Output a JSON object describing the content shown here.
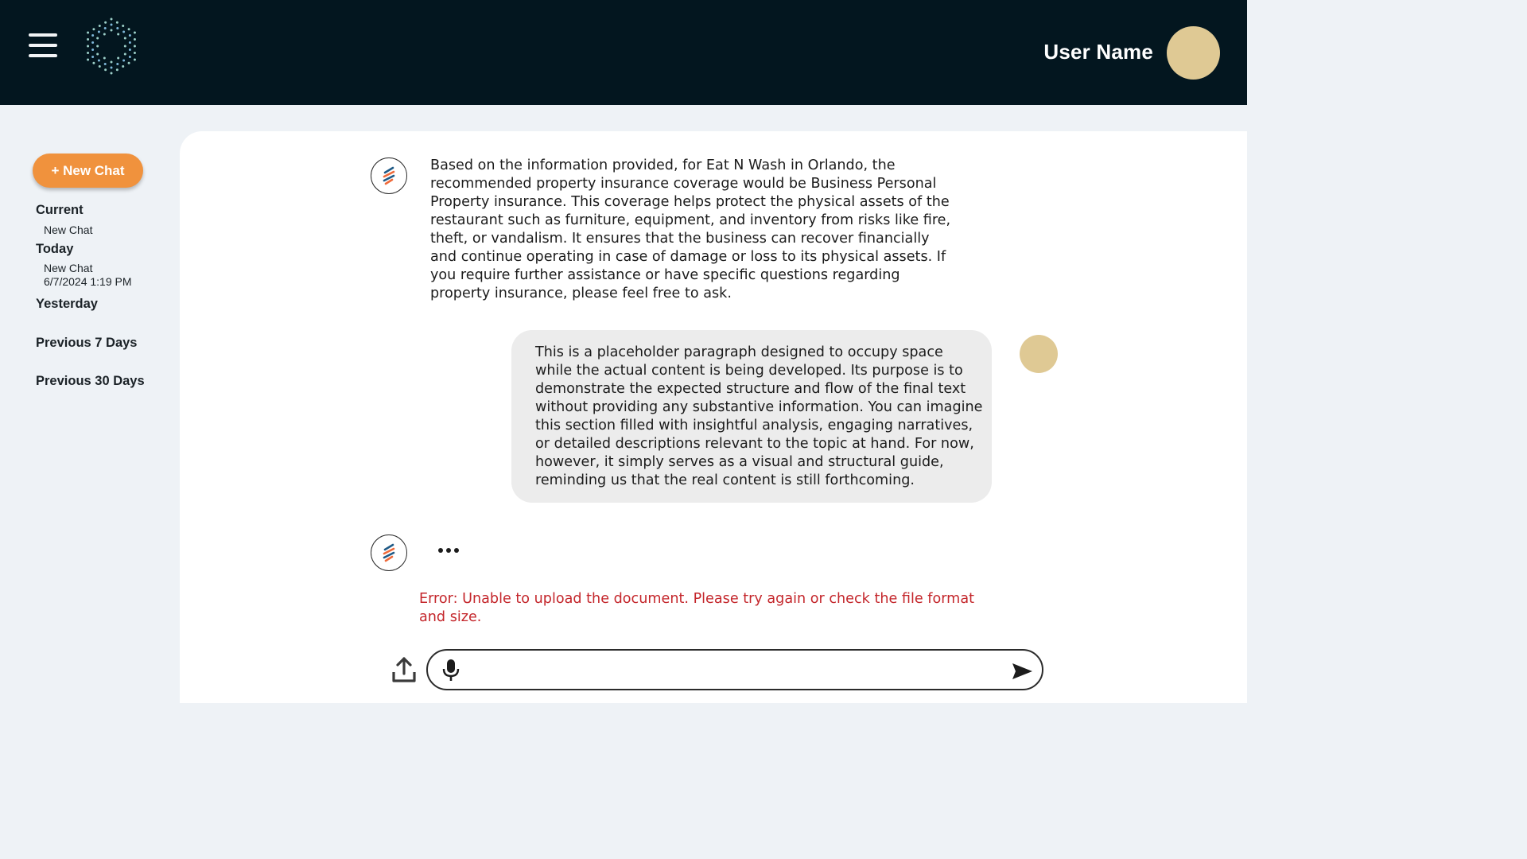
{
  "header": {
    "user_name": "User Name",
    "menu_icon": "hamburger-menu-icon",
    "logo_icon": "hexagon-dots-logo",
    "avatar_color": "#dfc994",
    "background_color": "#03161f"
  },
  "sidebar": {
    "new_chat_label": "+ New Chat",
    "new_chat_color": "#f0923d",
    "sections": [
      {
        "heading": "Current",
        "items": [
          "New Chat"
        ]
      },
      {
        "heading": "Today",
        "items": [
          "New Chat",
          "6/7/2024 1:19 PM"
        ]
      },
      {
        "heading": "Yesterday",
        "items": []
      },
      {
        "heading": "Previous 7 Days",
        "items": []
      },
      {
        "heading": "Previous 30 Days",
        "items": []
      }
    ]
  },
  "chat": {
    "messages": [
      {
        "role": "assistant",
        "text": "Based on the information provided, for Eat N Wash in Orlando, the recommended property insurance coverage would be Business Personal Property insurance. This coverage helps protect the physical assets of the restaurant such as furniture, equipment, and inventory from risks like fire, theft, or vandalism. It ensures that the business can recover financially and continue operating in case of damage or loss to its physical assets. If you require further assistance or have specific questions regarding property insurance, please feel free to ask."
      },
      {
        "role": "user",
        "text": "This is a placeholder paragraph designed to occupy space while the actual content is being developed. Its purpose is to demonstrate the expected structure and flow of the final text without providing any substantive information. You can imagine this section filled with insightful analysis, engaging narratives, or detailed descriptions relevant to the topic at hand. For now, however, it simply serves as a visual and structural guide, reminding us that the real content is still forthcoming."
      },
      {
        "role": "assistant",
        "text": "...",
        "status": "typing"
      }
    ],
    "error_text": "Error: Unable to upload the document. Please try again or check the file format and size.",
    "error_color": "#c4262b",
    "bot_icon": "stacked-stripes-icon",
    "user_avatar_color": "#dfc994"
  },
  "composer": {
    "value": "",
    "placeholder": "",
    "upload_icon": "upload-icon",
    "mic_icon": "microphone-icon",
    "send_icon": "send-icon"
  }
}
